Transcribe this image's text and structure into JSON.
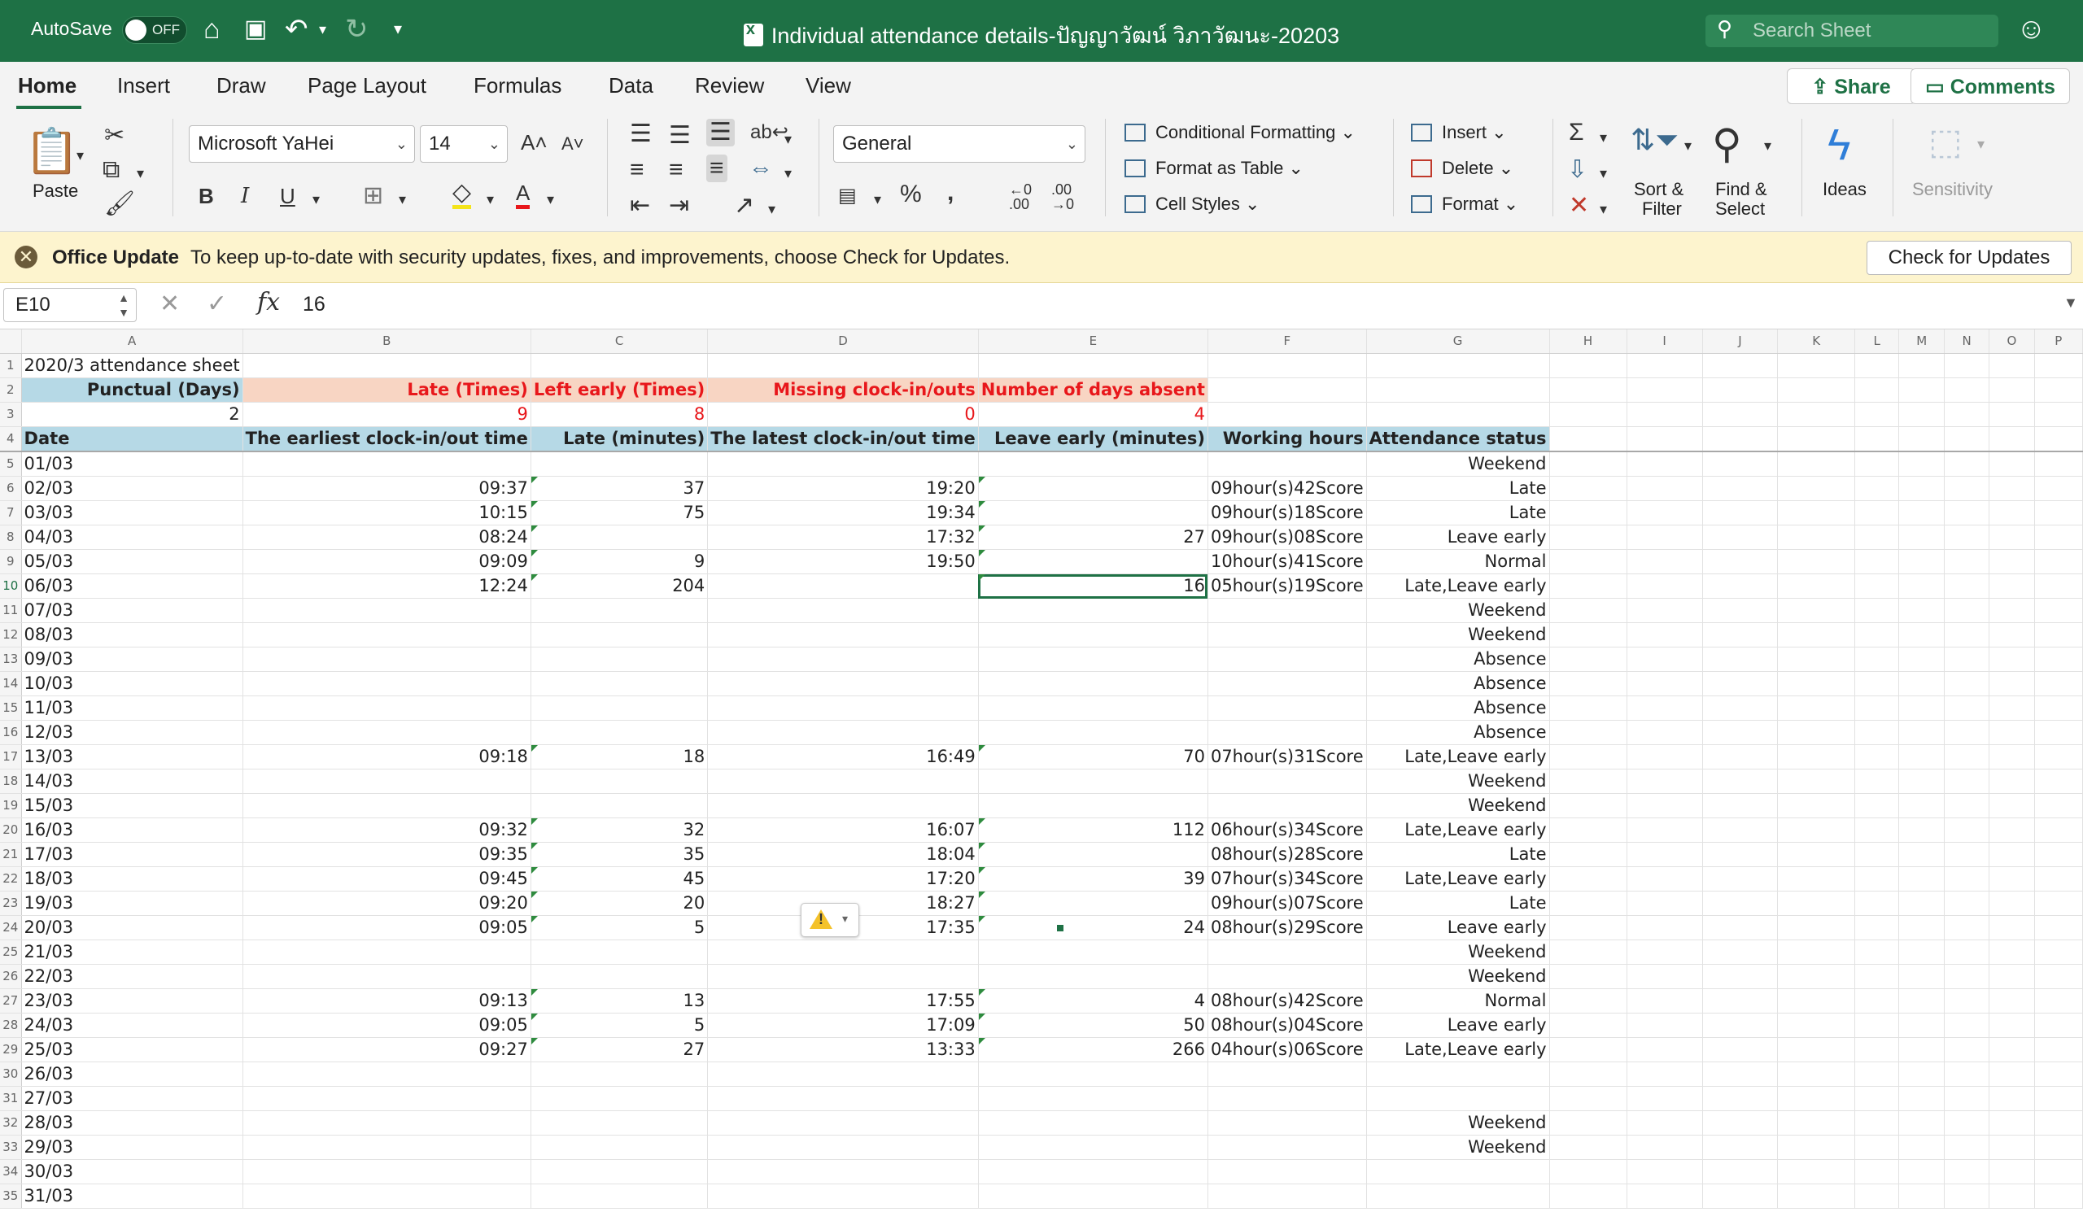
{
  "titlebar": {
    "autosave_label": "AutoSave",
    "autosave_state": "OFF",
    "document_title": "Individual attendance details-ปัญญาวัฒน์ วิภาวัฒนะ-20203",
    "search_placeholder": "Search Sheet"
  },
  "tabs": [
    "Home",
    "Insert",
    "Draw",
    "Page Layout",
    "Formulas",
    "Data",
    "Review",
    "View"
  ],
  "share_label": "Share",
  "comments_label": "Comments",
  "ribbon": {
    "paste_label": "Paste",
    "font_name": "Microsoft YaHei",
    "font_size": "14",
    "number_format": "General",
    "conditional_formatting": "Conditional Formatting",
    "format_as_table": "Format as Table",
    "cell_styles": "Cell Styles",
    "insert": "Insert",
    "delete": "Delete",
    "format": "Format",
    "sort_filter_1": "Sort &",
    "sort_filter_2": "Filter",
    "find_select_1": "Find &",
    "find_select_2": "Select",
    "ideas": "Ideas",
    "sensitivity": "Sensitivity"
  },
  "notification": {
    "title": "Office Update",
    "message": "To keep up-to-date with security updates, fixes, and improvements, choose Check for Updates.",
    "button": "Check for Updates"
  },
  "formula_bar": {
    "cell_ref": "E10",
    "value": "16"
  },
  "columns": [
    "A",
    "B",
    "C",
    "D",
    "E",
    "F",
    "G",
    "H",
    "I",
    "J",
    "K",
    "L",
    "M",
    "N",
    "O",
    "P"
  ],
  "sheet": {
    "title": "2020/3 attendance sheet",
    "summary_headers": [
      "Punctual (Days)",
      "Late (Times)",
      "Left early (Times)",
      "Missing clock-in/outs",
      "Number of days absent"
    ],
    "summary_values": [
      "2",
      "9",
      "8",
      "0",
      "4"
    ],
    "table_headers": [
      "Date",
      "The earliest clock-in/out time",
      "Late (minutes)",
      "The latest clock-in/out time",
      "Leave early (minutes)",
      "Working hours",
      "Attendance status"
    ],
    "rows": [
      [
        "01/03",
        "",
        "",
        "",
        "",
        "",
        "Weekend"
      ],
      [
        "02/03",
        "09:37",
        "37",
        "19:20",
        "",
        "09hour(s)42Score",
        "Late"
      ],
      [
        "03/03",
        "10:15",
        "75",
        "19:34",
        "",
        "09hour(s)18Score",
        "Late"
      ],
      [
        "04/03",
        "08:24",
        "",
        "17:32",
        "27",
        "09hour(s)08Score",
        "Leave early"
      ],
      [
        "05/03",
        "09:09",
        "9",
        "19:50",
        "",
        "10hour(s)41Score",
        "Normal"
      ],
      [
        "06/03",
        "12:24",
        "204",
        "",
        "16",
        "05hour(s)19Score",
        "Late,Leave early"
      ],
      [
        "07/03",
        "",
        "",
        "",
        "",
        "",
        "Weekend"
      ],
      [
        "08/03",
        "",
        "",
        "",
        "",
        "",
        "Weekend"
      ],
      [
        "09/03",
        "",
        "",
        "",
        "",
        "",
        "Absence"
      ],
      [
        "10/03",
        "",
        "",
        "",
        "",
        "",
        "Absence"
      ],
      [
        "11/03",
        "",
        "",
        "",
        "",
        "",
        "Absence"
      ],
      [
        "12/03",
        "",
        "",
        "",
        "",
        "",
        "Absence"
      ],
      [
        "13/03",
        "09:18",
        "18",
        "16:49",
        "70",
        "07hour(s)31Score",
        "Late,Leave early"
      ],
      [
        "14/03",
        "",
        "",
        "",
        "",
        "",
        "Weekend"
      ],
      [
        "15/03",
        "",
        "",
        "",
        "",
        "",
        "Weekend"
      ],
      [
        "16/03",
        "09:32",
        "32",
        "16:07",
        "112",
        "06hour(s)34Score",
        "Late,Leave early"
      ],
      [
        "17/03",
        "09:35",
        "35",
        "18:04",
        "",
        "08hour(s)28Score",
        "Late"
      ],
      [
        "18/03",
        "09:45",
        "45",
        "17:20",
        "39",
        "07hour(s)34Score",
        "Late,Leave early"
      ],
      [
        "19/03",
        "09:20",
        "20",
        "18:27",
        "",
        "09hour(s)07Score",
        "Late"
      ],
      [
        "20/03",
        "09:05",
        "5",
        "17:35",
        "24",
        "08hour(s)29Score",
        "Leave early"
      ],
      [
        "21/03",
        "",
        "",
        "",
        "",
        "",
        "Weekend"
      ],
      [
        "22/03",
        "",
        "",
        "",
        "",
        "",
        "Weekend"
      ],
      [
        "23/03",
        "09:13",
        "13",
        "17:55",
        "4",
        "08hour(s)42Score",
        "Normal"
      ],
      [
        "24/03",
        "09:05",
        "5",
        "17:09",
        "50",
        "08hour(s)04Score",
        "Leave early"
      ],
      [
        "25/03",
        "09:27",
        "27",
        "13:33",
        "266",
        "04hour(s)06Score",
        "Late,Leave early"
      ],
      [
        "26/03",
        "",
        "",
        "",
        "",
        "",
        ""
      ],
      [
        "27/03",
        "",
        "",
        "",
        "",
        "",
        ""
      ],
      [
        "28/03",
        "",
        "",
        "",
        "",
        "",
        "Weekend"
      ],
      [
        "29/03",
        "",
        "",
        "",
        "",
        "",
        "Weekend"
      ],
      [
        "30/03",
        "",
        "",
        "",
        "",
        "",
        ""
      ],
      [
        "31/03",
        "",
        "",
        "",
        "",
        "",
        ""
      ]
    ]
  },
  "colors": {
    "excel_green": "#1e7145",
    "header_blue": "#b6d9e6",
    "header_peach": "#f8d5c3",
    "alert_red": "#e8171b",
    "notification_yellow": "#fdf4ce"
  }
}
